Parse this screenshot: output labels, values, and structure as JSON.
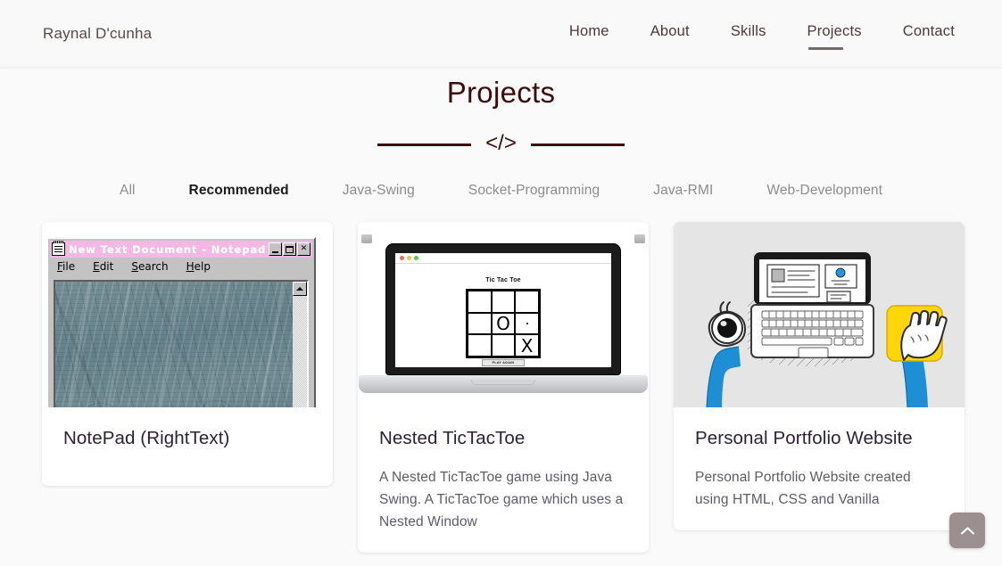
{
  "header": {
    "brand": "Raynal D'cunha",
    "nav": [
      {
        "label": "Home",
        "active": false
      },
      {
        "label": "About",
        "active": false
      },
      {
        "label": "Skills",
        "active": false
      },
      {
        "label": "Projects",
        "active": true
      },
      {
        "label": "Contact",
        "active": false
      }
    ]
  },
  "section": {
    "title": "Projects",
    "divider_icon": "</>"
  },
  "filters": [
    {
      "label": "All",
      "active": false
    },
    {
      "label": "Recommended",
      "active": true
    },
    {
      "label": "Java-Swing",
      "active": false
    },
    {
      "label": "Socket-Programming",
      "active": false
    },
    {
      "label": "Java-RMI",
      "active": false
    },
    {
      "label": "Web-Development",
      "active": false
    }
  ],
  "cards": [
    {
      "title": "NotePad (RightText)",
      "description": "",
      "media": "windows-notepad-screenshot"
    },
    {
      "title": "Nested TicTacToe",
      "description": "A Nested TicTacToe game using Java Swing. A TicTacToe game which uses a Nested Window",
      "media": "laptop-tictactoe-mockup"
    },
    {
      "title": "Personal Portfolio Website",
      "description": "Personal Portfolio Website created using HTML, CSS and Vanilla",
      "media": "portfolio-illustration"
    }
  ],
  "notepad": {
    "title": "New Text Document - Notepad",
    "menu": [
      "File",
      "Edit",
      "Search",
      "Help"
    ],
    "buttons": [
      "minimize",
      "maximize",
      "close"
    ],
    "titlebar_color": "#f4b8e4"
  },
  "tictactoe": {
    "title": "Tic Tac Toe",
    "cells": [
      "",
      "",
      "",
      "",
      "O",
      ".",
      "",
      "",
      "X"
    ],
    "button_label": "PLAY AGAIN",
    "window_dots": [
      "#ec6a5f",
      "#f4bf4f",
      "#61c555"
    ]
  },
  "scroll_top": {
    "label": "scroll to top",
    "color": "#9b8f8f"
  },
  "theme": {
    "accent": "#3b0d0d",
    "nav_text": "#4b3a39",
    "page_bg": "#fafafa",
    "card_bg": "#ffffff",
    "muted_text": "#8c8c8c"
  }
}
